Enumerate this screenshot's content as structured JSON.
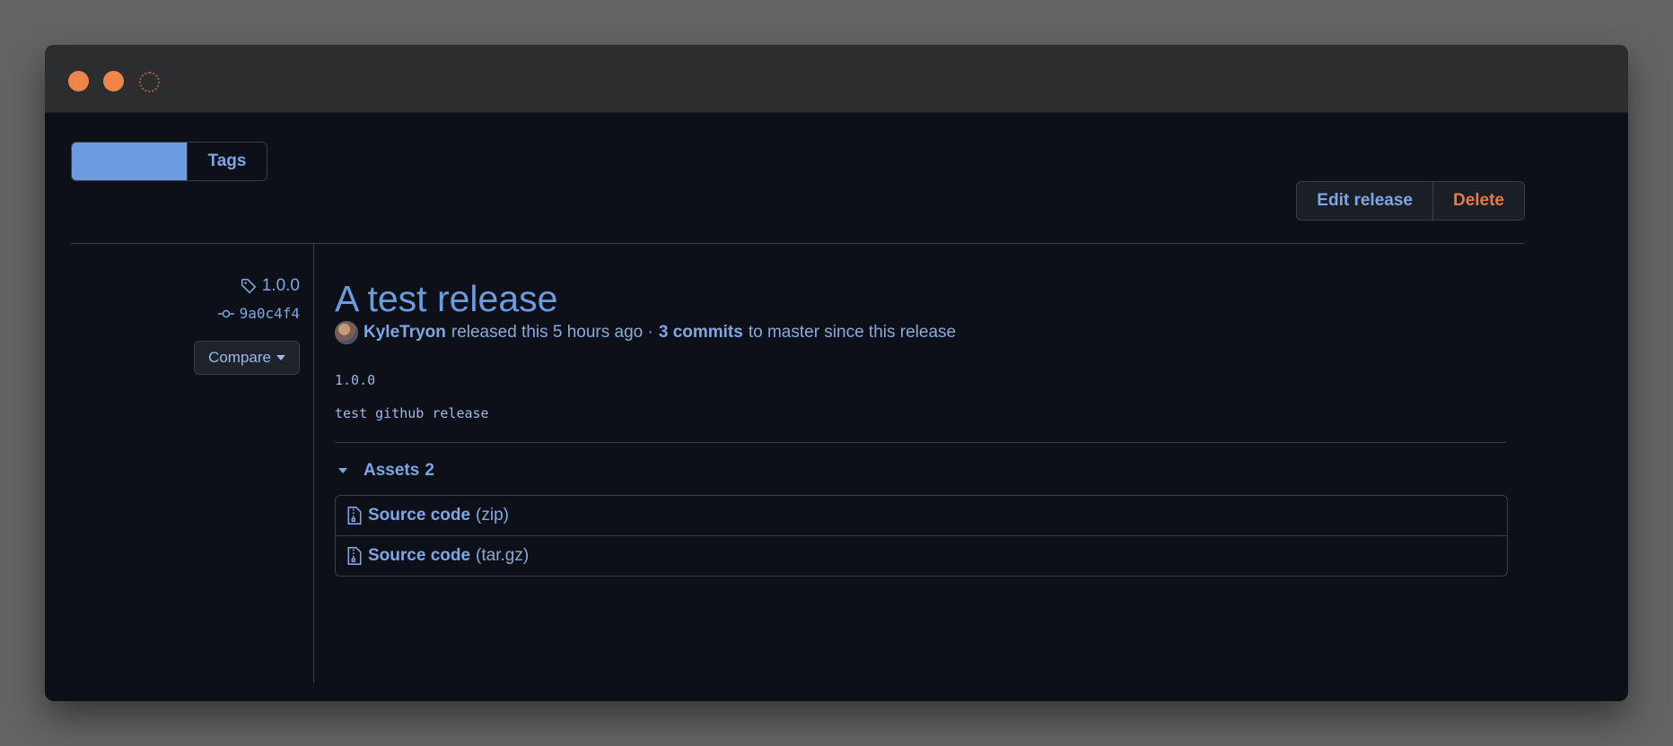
{
  "colors": {
    "background": "#0d1017",
    "accent": "#6b9be0",
    "link": "#7ea6e6",
    "danger": "#e07d4a",
    "border": "#3a3f47"
  },
  "window": {
    "controls": [
      "close",
      "minimize",
      "maximize"
    ]
  },
  "tabs": {
    "releases_label": "",
    "tags_label": "Tags"
  },
  "actions": {
    "edit_label": "Edit release",
    "delete_label": "Delete"
  },
  "sidebar": {
    "tag": "1.0.0",
    "tag_icon": "tag-icon",
    "commit": "9a0c4f4",
    "commit_icon": "git-commit-icon",
    "compare_label": "Compare"
  },
  "release": {
    "title": "A test release",
    "author": "KyleTryon",
    "released_text": "released this 5 hours ago ·",
    "commits_link": "3 commits",
    "commits_suffix": "to master since this release",
    "version_text": "1.0.0",
    "description": "test github release"
  },
  "assets": {
    "label": "Assets",
    "count": "2",
    "items": [
      {
        "name": "Source code",
        "format": "(zip)",
        "icon": "file-zip-icon"
      },
      {
        "name": "Source code",
        "format": "(tar.gz)",
        "icon": "file-zip-icon"
      }
    ]
  }
}
